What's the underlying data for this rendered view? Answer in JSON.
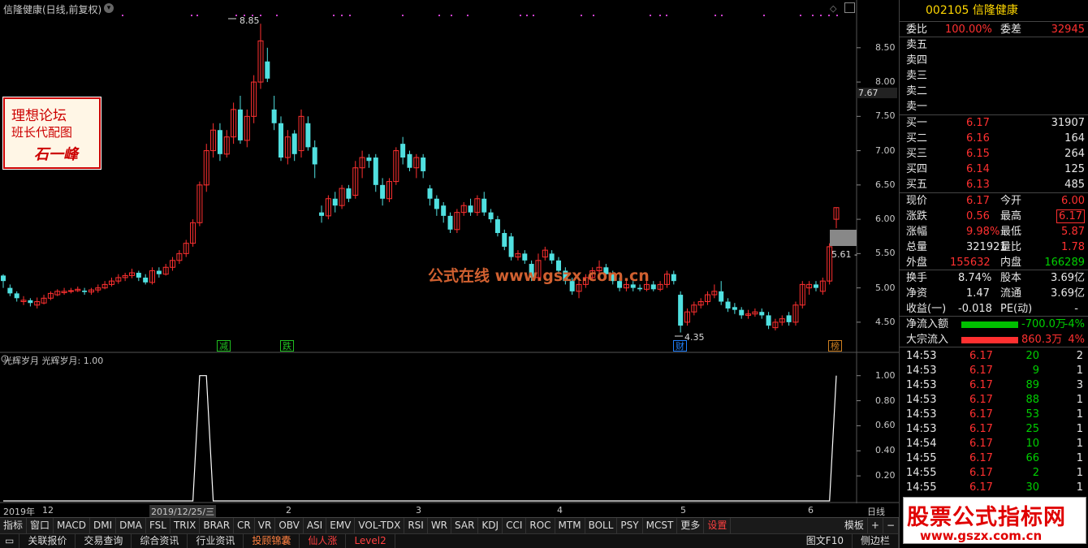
{
  "title": "信隆健康(日线,前复权)",
  "price_axis": [
    "8.50",
    "8.00",
    "7.50",
    "7.00",
    "6.50",
    "6.00",
    "5.50",
    "5.00",
    "4.50"
  ],
  "current_price_label": "7.67",
  "high_label": "8.85",
  "low_label": "4.35",
  "last_close_label": "5.61 -",
  "stamp": {
    "line1": "理想论坛",
    "line2": "班长代配图",
    "line3": "石一峰"
  },
  "watermark": "公式在线 www.gszx.com.cn",
  "signals": [
    {
      "text": "减",
      "color": "#20c020"
    },
    {
      "text": "跌",
      "color": "#20c020"
    },
    {
      "text": "财",
      "color": "#2080ff"
    },
    {
      "text": "榜",
      "color": "#d08020"
    }
  ],
  "indicator": {
    "title": "光辉岁月 光辉岁月: 1.00",
    "axis": [
      "1.00",
      "0.80",
      "0.60",
      "0.40",
      "0.20"
    ]
  },
  "date_axis": [
    "2019年",
    "12",
    "2019/12/25/三",
    "2",
    "3",
    "4",
    "5",
    "6"
  ],
  "timeframe": "日线",
  "tabs": [
    "指标",
    "窗口",
    "MACD",
    "DMI",
    "DMA",
    "FSL",
    "TRIX",
    "BRAR",
    "CR",
    "VR",
    "OBV",
    "ASI",
    "EMV",
    "VOL-TDX",
    "RSI",
    "WR",
    "SAR",
    "KDJ",
    "CCI",
    "ROC",
    "MTM",
    "BOLL",
    "PSY",
    "MCST",
    "更多",
    "设置",
    "模板",
    "+",
    "−"
  ],
  "bottom_tabs": [
    "关联报价",
    "交易查询",
    "综合资讯",
    "行业资讯",
    "投顾锦囊",
    "仙人涨",
    "Level2",
    "图文F10",
    "侧边栏"
  ],
  "side": {
    "code": "002105",
    "name": "信隆健康",
    "weibi_label": "委比",
    "weibi": "100.00%",
    "weicha_label": "委差",
    "weicha": "32945",
    "sells": [
      "卖五",
      "卖四",
      "卖三",
      "卖二",
      "卖一"
    ],
    "buys": [
      {
        "label": "买一",
        "price": "6.17",
        "vol": "31907"
      },
      {
        "label": "买二",
        "price": "6.16",
        "vol": "164"
      },
      {
        "label": "买三",
        "price": "6.15",
        "vol": "264"
      },
      {
        "label": "买四",
        "price": "6.14",
        "vol": "125"
      },
      {
        "label": "买五",
        "price": "6.13",
        "vol": "485"
      }
    ],
    "stats": [
      [
        "现价",
        "6.17",
        "今开",
        "6.00"
      ],
      [
        "涨跌",
        "0.56",
        "最高",
        "6.17"
      ],
      [
        "涨幅",
        "9.98%",
        "最低",
        "5.87"
      ],
      [
        "总量",
        "321921",
        "量比",
        "1.78"
      ],
      [
        "外盘",
        "155632",
        "内盘",
        "166289"
      ],
      [
        "换手",
        "8.74%",
        "股本",
        "3.69亿"
      ],
      [
        "净资",
        "1.47",
        "流通",
        "3.69亿"
      ],
      [
        "收益(一)",
        "-0.018",
        "PE(动)",
        "-"
      ]
    ],
    "netflow_label": "净流入额",
    "netflow": "-700.0万",
    "netflow_pct": "-4%",
    "block_label": "大宗流入",
    "block": "860.3万",
    "block_pct": "4%",
    "ticks": [
      [
        "14:53",
        "6.17",
        "20",
        "2"
      ],
      [
        "14:53",
        "6.17",
        "9",
        "1"
      ],
      [
        "14:53",
        "6.17",
        "89",
        "3"
      ],
      [
        "14:53",
        "6.17",
        "88",
        "1"
      ],
      [
        "14:53",
        "6.17",
        "53",
        "1"
      ],
      [
        "14:53",
        "6.17",
        "25",
        "1"
      ],
      [
        "14:54",
        "6.17",
        "10",
        "1"
      ],
      [
        "14:55",
        "6.17",
        "66",
        "1"
      ],
      [
        "14:55",
        "6.17",
        "2",
        "1"
      ],
      [
        "14:55",
        "6.17",
        "30",
        "1"
      ]
    ]
  },
  "logo": {
    "line1": "股票公式指标网",
    "line2": "www.gszx.com.cn"
  },
  "chart_data": {
    "type": "candlestick",
    "ylim": [
      4.25,
      8.9
    ],
    "colors": {
      "up": "#ff3030",
      "down": "#50e0e0"
    },
    "candles": [
      [
        5.18,
        5.1,
        5.2,
        5.0
      ],
      [
        5.0,
        4.92,
        5.05,
        4.88
      ],
      [
        4.92,
        4.85,
        4.95,
        4.8
      ],
      [
        4.8,
        4.82,
        4.88,
        4.75
      ],
      [
        4.82,
        4.78,
        4.85,
        4.73
      ],
      [
        4.75,
        4.8,
        4.86,
        4.7
      ],
      [
        4.78,
        4.85,
        4.9,
        4.76
      ],
      [
        4.85,
        4.92,
        4.95,
        4.82
      ],
      [
        4.9,
        4.95,
        4.98,
        4.88
      ],
      [
        4.93,
        4.95,
        5.0,
        4.9
      ],
      [
        4.95,
        4.96,
        5.0,
        4.92
      ],
      [
        4.96,
        4.98,
        5.02,
        4.94
      ],
      [
        4.96,
        4.94,
        5.0,
        4.9
      ],
      [
        4.94,
        4.97,
        5.0,
        4.9
      ],
      [
        4.97,
        5.0,
        5.05,
        4.93
      ],
      [
        5.0,
        5.05,
        5.1,
        4.98
      ],
      [
        5.05,
        5.1,
        5.15,
        5.02
      ],
      [
        5.1,
        5.15,
        5.2,
        5.06
      ],
      [
        5.15,
        5.18,
        5.22,
        5.1
      ],
      [
        5.18,
        5.22,
        5.28,
        5.14
      ],
      [
        5.22,
        5.15,
        5.25,
        5.1
      ],
      [
        5.15,
        5.08,
        5.2,
        5.05
      ],
      [
        5.08,
        5.25,
        5.3,
        5.05
      ],
      [
        5.25,
        5.2,
        5.3,
        5.15
      ],
      [
        5.2,
        5.3,
        5.35,
        5.18
      ],
      [
        5.3,
        5.4,
        5.45,
        5.25
      ],
      [
        5.4,
        5.5,
        5.55,
        5.35
      ],
      [
        5.5,
        5.65,
        5.7,
        5.45
      ],
      [
        5.65,
        5.95,
        6.0,
        5.6
      ],
      [
        5.95,
        6.5,
        6.55,
        5.9
      ],
      [
        6.5,
        7.0,
        7.1,
        6.4
      ],
      [
        7.0,
        7.3,
        7.4,
        6.9
      ],
      [
        7.3,
        6.95,
        7.4,
        6.85
      ],
      [
        6.95,
        7.2,
        7.3,
        6.9
      ],
      [
        7.2,
        7.6,
        7.7,
        7.1
      ],
      [
        7.6,
        7.15,
        7.8,
        7.1
      ],
      [
        7.15,
        7.5,
        7.6,
        7.05
      ],
      [
        7.5,
        8.0,
        8.1,
        7.4
      ],
      [
        8.0,
        8.6,
        8.85,
        7.9
      ],
      [
        8.3,
        8.05,
        8.5,
        8.0
      ],
      [
        7.6,
        7.4,
        7.8,
        7.3
      ],
      [
        7.4,
        6.9,
        7.5,
        6.85
      ],
      [
        6.9,
        7.2,
        7.3,
        6.8
      ],
      [
        7.25,
        6.95,
        7.3,
        6.85
      ],
      [
        7.0,
        7.5,
        7.6,
        6.9
      ],
      [
        7.4,
        7.05,
        7.5,
        7.0
      ],
      [
        7.05,
        6.8,
        7.15,
        6.6
      ],
      [
        6.1,
        6.05,
        6.2,
        5.95
      ],
      [
        6.05,
        6.3,
        6.35,
        6.0
      ],
      [
        6.3,
        6.2,
        6.4,
        6.1
      ],
      [
        6.2,
        6.45,
        6.5,
        6.15
      ],
      [
        6.45,
        6.3,
        6.5,
        6.25
      ],
      [
        6.35,
        6.75,
        6.85,
        6.3
      ],
      [
        6.75,
        6.9,
        7.0,
        6.6
      ],
      [
        6.9,
        6.85,
        6.95,
        6.75
      ],
      [
        6.9,
        6.5,
        6.95,
        6.4
      ],
      [
        6.5,
        6.3,
        6.6,
        6.2
      ],
      [
        6.3,
        6.55,
        6.6,
        6.25
      ],
      [
        6.55,
        7.0,
        7.05,
        6.5
      ],
      [
        7.1,
        6.9,
        7.2,
        6.8
      ],
      [
        6.95,
        6.75,
        7.0,
        6.7
      ],
      [
        6.75,
        6.9,
        6.95,
        6.6
      ],
      [
        6.9,
        6.7,
        6.95,
        6.6
      ],
      [
        6.45,
        6.3,
        6.5,
        6.2
      ],
      [
        6.3,
        6.15,
        6.35,
        6.05
      ],
      [
        6.2,
        6.05,
        6.25,
        5.95
      ],
      [
        6.05,
        5.85,
        6.1,
        5.8
      ],
      [
        5.85,
        6.1,
        6.15,
        5.8
      ],
      [
        6.1,
        6.2,
        6.25,
        6.05
      ],
      [
        6.2,
        6.1,
        6.3,
        6.05
      ],
      [
        6.1,
        6.3,
        6.35,
        6.05
      ],
      [
        6.3,
        6.1,
        6.4,
        6.05
      ],
      [
        6.1,
        6.0,
        6.15,
        5.95
      ],
      [
        6.0,
        5.8,
        6.05,
        5.75
      ],
      [
        5.8,
        5.6,
        5.85,
        5.55
      ],
      [
        5.75,
        5.45,
        5.8,
        5.4
      ],
      [
        5.45,
        5.5,
        5.55,
        5.4
      ],
      [
        5.5,
        5.4,
        5.55,
        5.35
      ],
      [
        5.35,
        5.15,
        5.4,
        5.1
      ],
      [
        5.15,
        5.4,
        5.5,
        5.1
      ],
      [
        5.45,
        5.55,
        5.6,
        5.4
      ],
      [
        5.5,
        5.4,
        5.55,
        5.35
      ],
      [
        5.4,
        5.25,
        5.45,
        5.2
      ],
      [
        5.25,
        5.1,
        5.3,
        5.05
      ],
      [
        5.1,
        4.95,
        5.15,
        4.9
      ],
      [
        4.95,
        5.05,
        5.1,
        4.85
      ],
      [
        5.05,
        5.15,
        5.2,
        5.0
      ],
      [
        5.15,
        5.25,
        5.3,
        5.1
      ],
      [
        5.25,
        5.3,
        5.4,
        5.2
      ],
      [
        5.3,
        5.2,
        5.35,
        5.15
      ],
      [
        5.2,
        5.1,
        5.25,
        5.05
      ],
      [
        5.1,
        5.0,
        5.15,
        4.95
      ],
      [
        5.0,
        5.05,
        5.1,
        4.95
      ],
      [
        5.05,
        5.0,
        5.1,
        4.95
      ],
      [
        5.0,
        4.98,
        5.05,
        4.95
      ],
      [
        4.98,
        5.05,
        5.1,
        4.95
      ],
      [
        5.05,
        4.98,
        5.1,
        4.95
      ],
      [
        4.98,
        5.05,
        5.1,
        4.95
      ],
      [
        5.05,
        5.2,
        5.25,
        5.0
      ],
      [
        5.2,
        5.1,
        5.25,
        5.05
      ],
      [
        4.9,
        4.45,
        4.95,
        4.35
      ],
      [
        4.5,
        4.65,
        4.7,
        4.45
      ],
      [
        4.65,
        4.75,
        4.8,
        4.6
      ],
      [
        4.75,
        4.8,
        4.85,
        4.7
      ],
      [
        4.8,
        4.9,
        4.95,
        4.75
      ],
      [
        4.9,
        4.95,
        5.05,
        4.85
      ],
      [
        4.95,
        4.8,
        5.1,
        4.75
      ],
      [
        4.8,
        4.7,
        4.85,
        4.65
      ],
      [
        4.72,
        4.68,
        4.78,
        4.62
      ],
      [
        4.68,
        4.6,
        4.72,
        4.55
      ],
      [
        4.6,
        4.62,
        4.68,
        4.55
      ],
      [
        4.62,
        4.65,
        4.7,
        4.58
      ],
      [
        4.65,
        4.6,
        4.7,
        4.55
      ],
      [
        4.6,
        4.45,
        4.65,
        4.4
      ],
      [
        4.42,
        4.5,
        4.55,
        4.38
      ],
      [
        4.5,
        4.55,
        4.6,
        4.45
      ],
      [
        4.6,
        4.5,
        4.65,
        4.45
      ],
      [
        4.5,
        4.75,
        4.8,
        4.45
      ],
      [
        4.75,
        5.05,
        5.1,
        4.7
      ],
      [
        5.0,
        5.05,
        5.1,
        4.9
      ],
      [
        5.05,
        5.0,
        5.1,
        4.95
      ],
      [
        4.95,
        5.1,
        5.15,
        4.9
      ],
      [
        5.1,
        5.6,
        5.65,
        5.05
      ],
      [
        6.0,
        6.17,
        6.17,
        5.87
      ]
    ],
    "indicator_series": [
      0,
      0,
      0,
      0,
      0,
      0,
      0,
      0,
      0,
      0,
      0,
      0,
      0,
      0,
      0,
      0,
      0,
      0,
      0,
      0,
      0,
      0,
      0,
      0,
      0,
      0,
      0,
      0,
      0,
      1,
      1,
      0,
      0,
      0,
      0,
      0,
      0,
      0,
      0,
      0,
      0,
      0,
      0,
      0,
      0,
      0,
      0,
      0,
      0,
      0,
      0,
      0,
      0,
      0,
      0,
      0,
      0,
      0,
      0,
      0,
      0,
      0,
      0,
      0,
      0,
      0,
      0,
      0,
      0,
      0,
      0,
      0,
      0,
      0,
      0,
      0,
      0,
      0,
      0,
      0,
      0,
      0,
      0,
      0,
      0,
      0,
      0,
      0,
      0,
      0,
      0,
      0,
      0,
      0,
      0,
      0,
      0,
      0,
      0,
      0,
      0,
      0,
      0,
      0,
      0,
      0,
      0,
      0,
      0,
      0,
      0,
      0,
      0,
      0,
      0,
      0,
      0,
      0,
      0,
      0,
      0,
      0,
      0,
      1
    ],
    "indicator_ylim": [
      0,
      1.05
    ]
  }
}
